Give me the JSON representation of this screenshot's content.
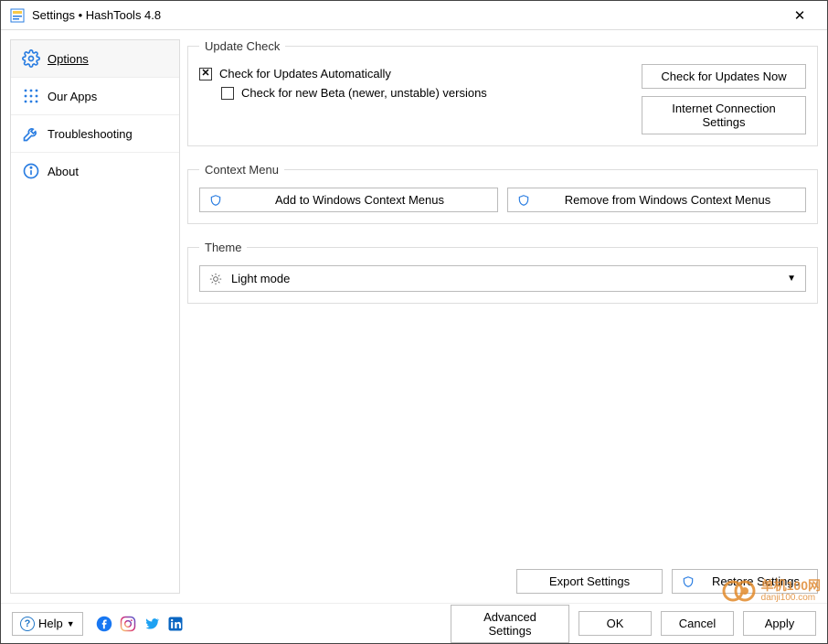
{
  "window": {
    "title": "Settings • HashTools 4.8"
  },
  "sidebar": {
    "items": [
      {
        "label": "Options",
        "active": true
      },
      {
        "label": "Our Apps",
        "active": false
      },
      {
        "label": "Troubleshooting",
        "active": false
      },
      {
        "label": "About",
        "active": false
      }
    ]
  },
  "updateCheck": {
    "legend": "Update Check",
    "auto_label": "Check for Updates Automatically",
    "auto_checked": true,
    "beta_label": "Check for new Beta (newer, unstable) versions",
    "beta_checked": false,
    "now_button": "Check for Updates Now",
    "connection_button": "Internet Connection Settings"
  },
  "contextMenu": {
    "legend": "Context Menu",
    "add_button": "Add to Windows Context Menus",
    "remove_button": "Remove from Windows Context Menus"
  },
  "theme": {
    "legend": "Theme",
    "selected": "Light mode"
  },
  "mainFooter": {
    "export_button": "Export Settings",
    "restore_button": "Restore Settings"
  },
  "footer": {
    "help_label": "Help",
    "advanced_button": "Advanced Settings",
    "ok_button": "OK",
    "cancel_button": "Cancel",
    "apply_button": "Apply"
  },
  "watermark": {
    "cn": "单机100网",
    "url": "danji100.com"
  }
}
